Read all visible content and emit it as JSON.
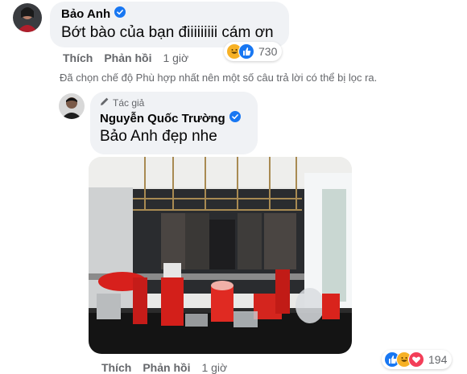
{
  "comment1": {
    "author": "Bảo Anh",
    "text": "Bớt bào của bạn điiiiiiiii cám ơn",
    "like_label": "Thích",
    "reply_label": "Phản hồi",
    "time": "1 giờ",
    "reaction_count": "730",
    "reaction_icons": [
      "haha-icon",
      "like-icon"
    ]
  },
  "filter_note": "Đã chọn chế độ Phù hợp nhất nên một số câu trả lời có thể bị lọc ra.",
  "reply1": {
    "badge": "Tác giả",
    "author": "Nguyễn Quốc Trường",
    "text": "Bảo Anh đẹp nhe",
    "photo_icon": "kitchen-photo",
    "like_label": "Thích",
    "reply_label": "Phản hồi",
    "time": "1 giờ",
    "reaction_count": "194",
    "reaction_icons": [
      "like-icon",
      "haha-icon",
      "love-icon"
    ]
  },
  "colors": {
    "bubble": "#f0f2f5",
    "secondary_text": "#65676b",
    "verified_blue": "#1877f2",
    "like_blue": "#1877f2",
    "haha_yellow": "#f7b125",
    "love_red": "#f33e58"
  }
}
